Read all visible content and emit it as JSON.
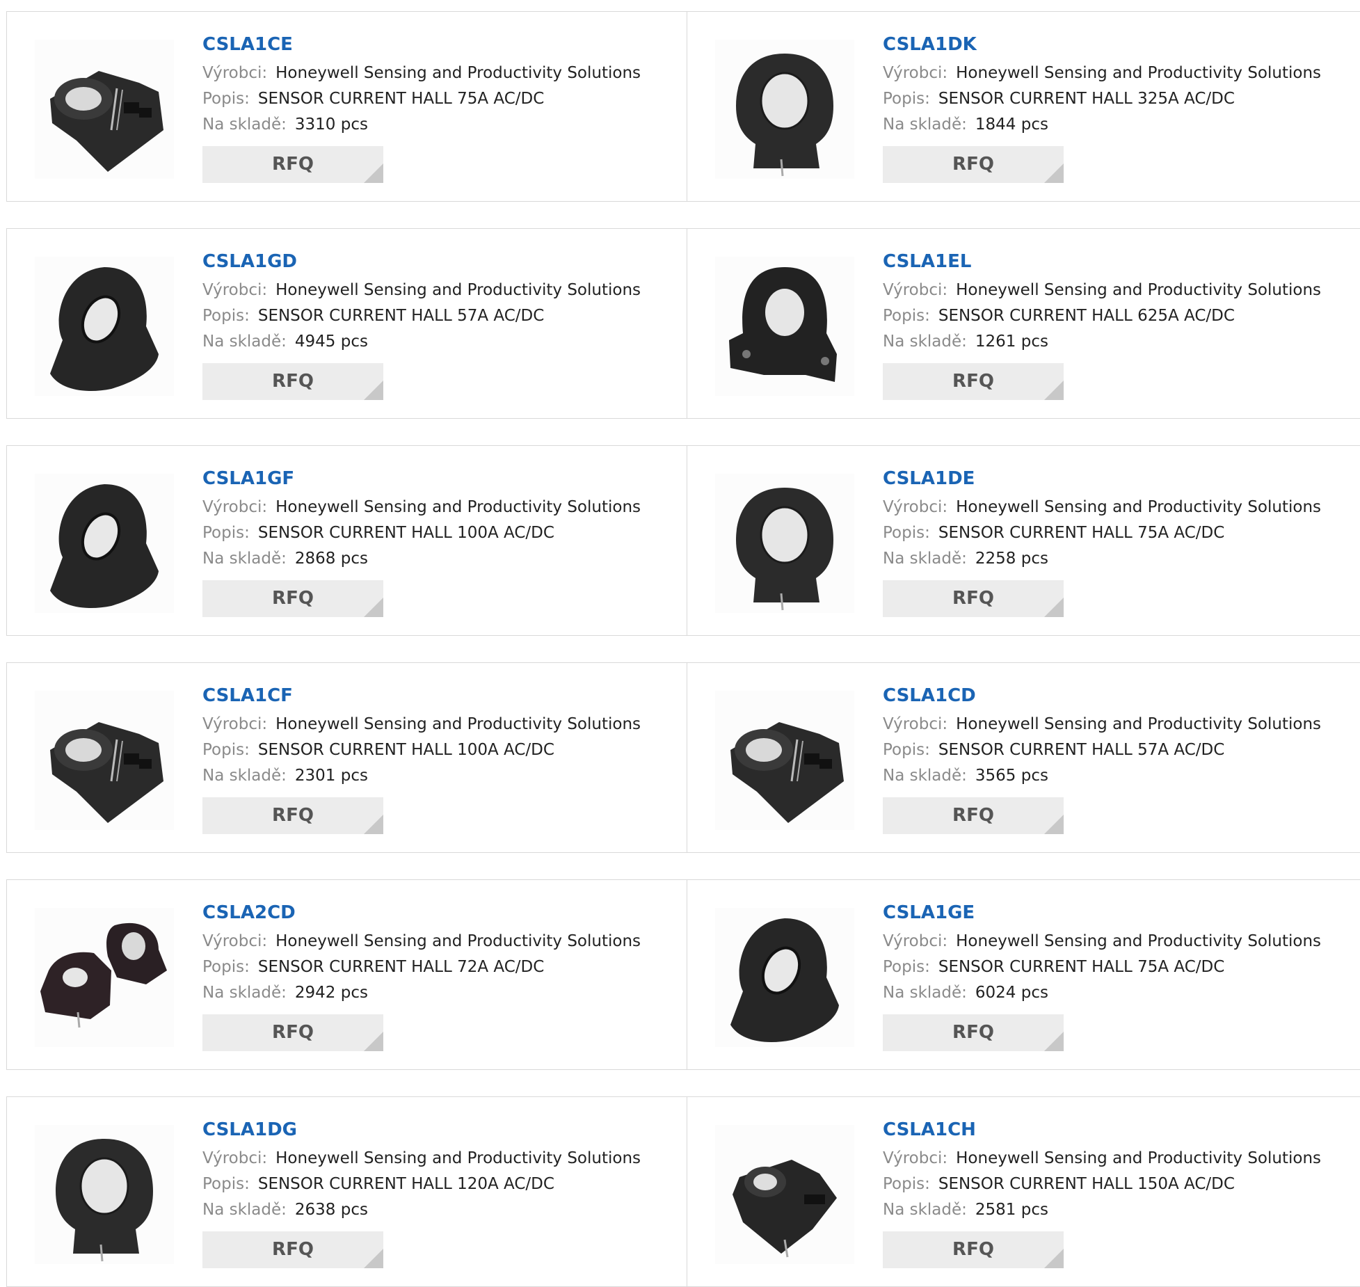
{
  "labels": {
    "manufacturer": "Výrobci:",
    "description": "Popis:",
    "stock": "Na skladě:",
    "rfq": "RFQ"
  },
  "products": [
    {
      "pn": "CSLA1CE",
      "manufacturer": "Honeywell Sensing and Productivity Solutions",
      "description": "SENSOR CURRENT HALL 75A AC/DC",
      "stock": "3310 pcs",
      "image_icon": "cs-sensor-with-pins-icon"
    },
    {
      "pn": "CSLA1DK",
      "manufacturer": "Honeywell Sensing and Productivity Solutions",
      "description": "SENSOR CURRENT HALL 325A AC/DC",
      "stock": "1844 pcs",
      "image_icon": "ring-sensor-upright-icon"
    },
    {
      "pn": "CSLA1GD",
      "manufacturer": "Honeywell Sensing and Productivity Solutions",
      "description": "SENSOR CURRENT HALL 57A AC/DC",
      "stock": "4945 pcs",
      "image_icon": "ring-sensor-tilted-icon"
    },
    {
      "pn": "CSLA1EL",
      "manufacturer": "Honeywell Sensing and Productivity Solutions",
      "description": "SENSOR CURRENT HALL 625A AC/DC",
      "stock": "1261 pcs",
      "image_icon": "ring-sensor-flanged-icon"
    },
    {
      "pn": "CSLA1GF",
      "manufacturer": "Honeywell Sensing and Productivity Solutions",
      "description": "SENSOR CURRENT HALL 100A AC/DC",
      "stock": "2868 pcs",
      "image_icon": "ring-sensor-tilted-icon"
    },
    {
      "pn": "CSLA1DE",
      "manufacturer": "Honeywell Sensing and Productivity Solutions",
      "description": "SENSOR CURRENT HALL 75A AC/DC",
      "stock": "2258 pcs",
      "image_icon": "ring-sensor-upright-icon"
    },
    {
      "pn": "CSLA1CF",
      "manufacturer": "Honeywell Sensing and Productivity Solutions",
      "description": "SENSOR CURRENT HALL 100A AC/DC",
      "stock": "2301 pcs",
      "image_icon": "cs-sensor-with-pins-icon"
    },
    {
      "pn": "CSLA1CD",
      "manufacturer": "Honeywell Sensing and Productivity Solutions",
      "description": "SENSOR CURRENT HALL 57A AC/DC",
      "stock": "3565 pcs",
      "image_icon": "cs-sensor-with-pins-icon"
    },
    {
      "pn": "CSLA2CD",
      "manufacturer": "Honeywell Sensing and Productivity Solutions",
      "description": "SENSOR CURRENT HALL 72A AC/DC",
      "stock": "2942 pcs",
      "image_icon": "sensor-pair-icon"
    },
    {
      "pn": "CSLA1GE",
      "manufacturer": "Honeywell Sensing and Productivity Solutions",
      "description": "SENSOR CURRENT HALL 75A AC/DC",
      "stock": "6024 pcs",
      "image_icon": "ring-sensor-tilted-icon"
    },
    {
      "pn": "CSLA1DG",
      "manufacturer": "Honeywell Sensing and Productivity Solutions",
      "description": "SENSOR CURRENT HALL 120A AC/DC",
      "stock": "2638 pcs",
      "image_icon": "ring-sensor-upright-icon"
    },
    {
      "pn": "CSLA1CH",
      "manufacturer": "Honeywell Sensing and Productivity Solutions",
      "description": "SENSOR CURRENT HALL 150A AC/DC",
      "stock": "2581 pcs",
      "image_icon": "cs-sensor-small-icon"
    }
  ]
}
